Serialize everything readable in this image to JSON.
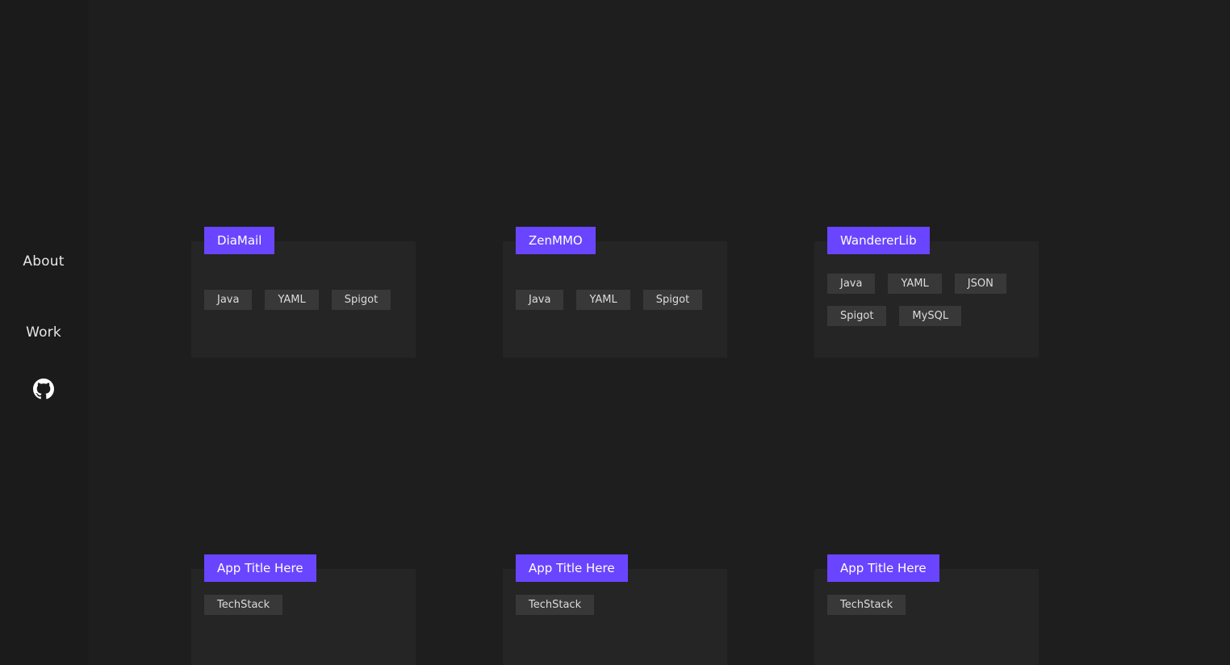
{
  "nav": {
    "about_label": "About",
    "work_label": "Work",
    "github_icon": "github-icon"
  },
  "colors": {
    "background": "#1e1e1e",
    "sidebar": "#1b1b1b",
    "card": "#252525",
    "accent": "#6a45ff",
    "tag": "#383838"
  },
  "projects": [
    {
      "title": "DiaMail",
      "tags": [
        "Java",
        "YAML",
        "Spigot"
      ]
    },
    {
      "title": "ZenMMO",
      "tags": [
        "Java",
        "YAML",
        "Spigot"
      ]
    },
    {
      "title": "WandererLib",
      "tags": [
        "Java",
        "YAML",
        "JSON",
        "Spigot",
        "MySQL"
      ]
    },
    {
      "title": "App Title Here",
      "tags": [
        "TechStack"
      ]
    },
    {
      "title": "App Title Here",
      "tags": [
        "TechStack"
      ]
    },
    {
      "title": "App Title Here",
      "tags": [
        "TechStack"
      ]
    }
  ]
}
